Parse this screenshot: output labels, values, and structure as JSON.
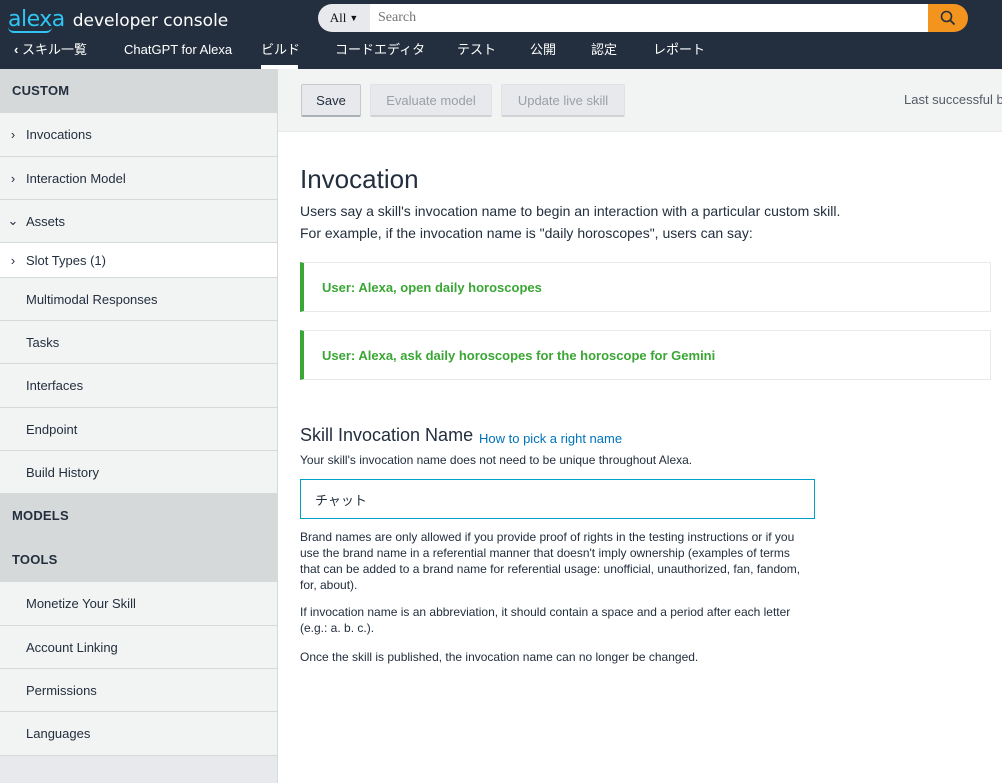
{
  "header": {
    "logo_text": "alexa",
    "console_text": "developer console",
    "search": {
      "scope": "All",
      "placeholder": "Search"
    },
    "nav": [
      {
        "label": "スキル一覧",
        "back": true
      },
      {
        "label": "ChatGPT for Alexa"
      },
      {
        "label": "ビルド",
        "active": true
      },
      {
        "label": "コードエディタ"
      },
      {
        "label": "テスト"
      },
      {
        "label": "公開"
      },
      {
        "label": "認定"
      },
      {
        "label": "レポート"
      }
    ]
  },
  "sidebar": {
    "custom": "CUSTOM",
    "items": [
      {
        "label": "Invocations",
        "chevron": "›"
      },
      {
        "label": "Interaction Model",
        "chevron": "›"
      },
      {
        "label": "Assets",
        "chevron": "⌄"
      },
      {
        "label": "Slot Types (1)",
        "chevron": "›"
      },
      {
        "label": "Multimodal Responses"
      },
      {
        "label": "Tasks"
      },
      {
        "label": "Interfaces"
      },
      {
        "label": "Endpoint"
      },
      {
        "label": "Build History"
      }
    ],
    "models": "MODELS",
    "tools": "TOOLS",
    "tool_items": [
      {
        "label": "Monetize Your Skill"
      },
      {
        "label": "Account Linking"
      },
      {
        "label": "Permissions"
      },
      {
        "label": "Languages"
      }
    ]
  },
  "toolbar": {
    "save": "Save",
    "evaluate": "Evaluate model",
    "update": "Update live skill",
    "last_build": "Last successful bu"
  },
  "main": {
    "title": "Invocation",
    "intro1": "Users say a skill's invocation name to begin an interaction with a particular custom skill.",
    "intro2": "For example, if the invocation name is \"daily horoscopes\", users can say:",
    "example1": "User: Alexa, open daily horoscopes",
    "example2": "User: Alexa, ask daily horoscopes for the horoscope for Gemini",
    "section_title": "Skill Invocation Name",
    "section_link": "How to pick a right name",
    "section_desc": "Your skill's invocation name does not need to be unique throughout Alexa.",
    "invocation_value": "チャット",
    "note1": "Brand names are only allowed if you provide proof of rights in the testing instructions or if you use the brand name in a referential manner that doesn't imply ownership (examples of terms that can be added to a brand name for referential usage: unofficial, unauthorized, fan, fandom, for, about).",
    "note2": "If invocation name is an abbreviation, it should contain a space and a period after each letter (e.g.: a. b. c.).",
    "note3": "Once the skill is published, the invocation name can no longer be changed."
  },
  "colors": {
    "topbar": "#232f3e",
    "accent_orange": "#f2941e",
    "alexa_blue": "#31c4f3",
    "example_green": "#3aa635",
    "link_blue": "#0073bb"
  }
}
